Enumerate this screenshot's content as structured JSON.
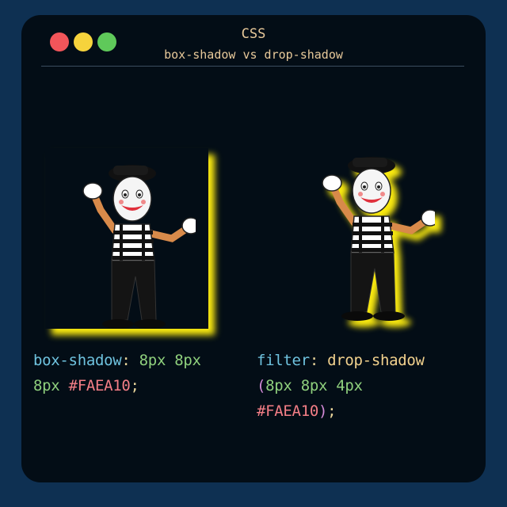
{
  "window": {
    "title": "CSS",
    "subtitle": "box-shadow vs drop-shadow"
  },
  "colors": {
    "shadow": "#FAEA10",
    "window_bg": "#030d16",
    "page_bg": "#0e3052",
    "dot_red": "#f2555a",
    "dot_yellow": "#f6d33c",
    "dot_green": "#5fc95a"
  },
  "left_example": {
    "property": "box-shadow",
    "colon": ":",
    "value_line1": "8px 8px",
    "value_line2": "8px",
    "color_value": "#FAEA10",
    "terminator": ";"
  },
  "right_example": {
    "property": "filter",
    "colon": ":",
    "function": "drop-shadow",
    "open_paren": "(",
    "args": "8px 8px 4px",
    "color_value": "#FAEA10",
    "close_paren": ")",
    "terminator": ";"
  },
  "illustrations": {
    "left": "mime-illustration",
    "right": "mime-illustration"
  }
}
